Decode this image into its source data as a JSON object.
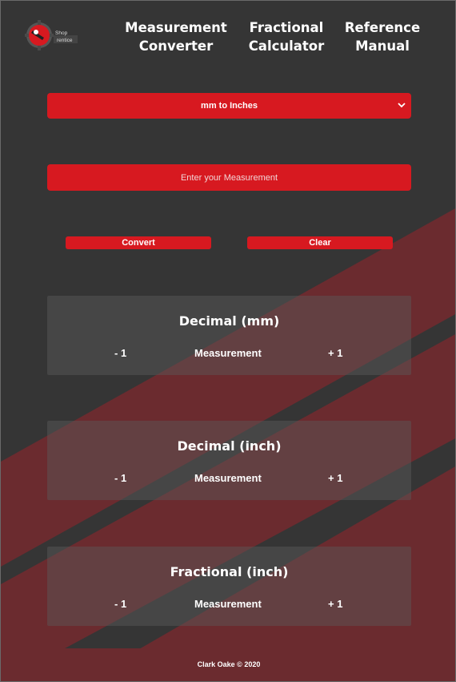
{
  "header": {
    "logo_text": [
      "Shop",
      "rentice"
    ],
    "nav": [
      {
        "line1": "Measurement",
        "line2": "Converter"
      },
      {
        "line1": "Fractional",
        "line2": "Calculator"
      },
      {
        "line1": "Reference",
        "line2": "Manual"
      }
    ]
  },
  "converter": {
    "mode_selected": "mm to Inches",
    "input_placeholder": "Enter your Measurement",
    "convert_label": "Convert",
    "clear_label": "Clear"
  },
  "results": [
    {
      "title": "Decimal (mm)",
      "minus": "- 1",
      "value": "Measurement",
      "plus": "+ 1"
    },
    {
      "title": "Decimal (inch)",
      "minus": "- 1",
      "value": "Measurement",
      "plus": "+ 1"
    },
    {
      "title": "Fractional (inch)",
      "minus": "- 1",
      "value": "Measurement",
      "plus": "+ 1"
    }
  ],
  "footer": {
    "text": "Clark Oake © 2020"
  },
  "colors": {
    "accent": "#d71920",
    "background": "#353535",
    "stripe": "#6b2b2f"
  },
  "icons": {
    "logo": "shop-apprentice-gear-logo",
    "select": "chevron-down-icon"
  }
}
